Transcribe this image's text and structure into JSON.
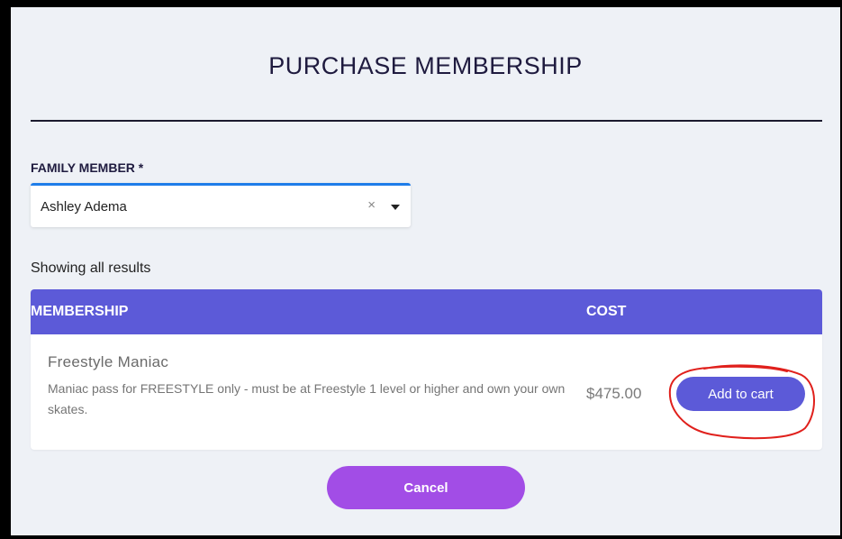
{
  "page": {
    "title": "PURCHASE MEMBERSHIP"
  },
  "family_member": {
    "label": "FAMILY MEMBER *",
    "selected_value": "Ashley Adema",
    "clear_symbol": "×"
  },
  "results": {
    "summary": "Showing all results"
  },
  "table": {
    "headers": {
      "membership": "MEMBERSHIP",
      "cost": "COST"
    },
    "rows": [
      {
        "name": "Freestyle Maniac",
        "description": "Maniac pass for FREESTYLE only - must be at Freestyle 1 level or higher and own your own skates.",
        "cost": "$475.00",
        "action_label": "Add to cart"
      }
    ]
  },
  "actions": {
    "cancel_label": "Cancel"
  },
  "colors": {
    "header_bg": "#5c5ad8",
    "cancel_bg": "#a24de6",
    "select_accent": "#1e7de9",
    "annotation": "#e0201c"
  },
  "icons": {
    "clear": "close-icon",
    "dropdown": "caret-down-icon"
  }
}
